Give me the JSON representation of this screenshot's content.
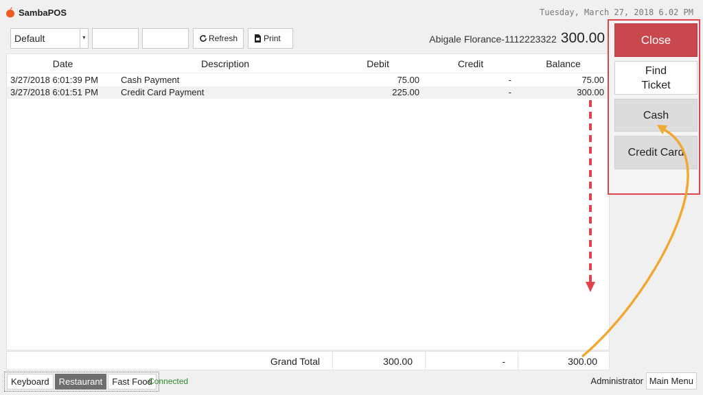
{
  "app": {
    "name": "SambaPOS",
    "datetime": "Tuesday, March 27, 2018 6.02 PM"
  },
  "toolbar": {
    "filter_value": "Default",
    "refresh_label": "Refresh",
    "print_label": "Print"
  },
  "customer": {
    "name": "Abigale Florance-1112223322",
    "total": "300.00"
  },
  "table": {
    "headers": {
      "date": "Date",
      "description": "Description",
      "debit": "Debit",
      "credit": "Credit",
      "balance": "Balance"
    },
    "rows": [
      {
        "date": "3/27/2018 6:01:39 PM",
        "description": "Cash Payment",
        "debit": "75.00",
        "credit": "-",
        "balance": "75.00"
      },
      {
        "date": "3/27/2018 6:01:51 PM",
        "description": "Credit Card Payment",
        "debit": "225.00",
        "credit": "-",
        "balance": "300.00"
      }
    ]
  },
  "totals": {
    "label": "Grand Total",
    "debit": "300.00",
    "credit": "-",
    "balance": "300.00"
  },
  "side_panel": {
    "close_label": "Close",
    "find_ticket_line1": "Find",
    "find_ticket_line2": "Ticket",
    "cash_label": "Cash",
    "credit_card_label": "Credit Card"
  },
  "bottom": {
    "tabs": [
      "Keyboard",
      "Restaurant",
      "Fast Food"
    ],
    "active_tab": "Restaurant",
    "status": "Connected",
    "user": "Administrator",
    "main_menu_label": "Main Menu"
  },
  "colors": {
    "close": "#c9484d",
    "highlight": "#e0434c",
    "arrow_yellow": "#f0a830",
    "status_green": "#2e8b2e"
  }
}
